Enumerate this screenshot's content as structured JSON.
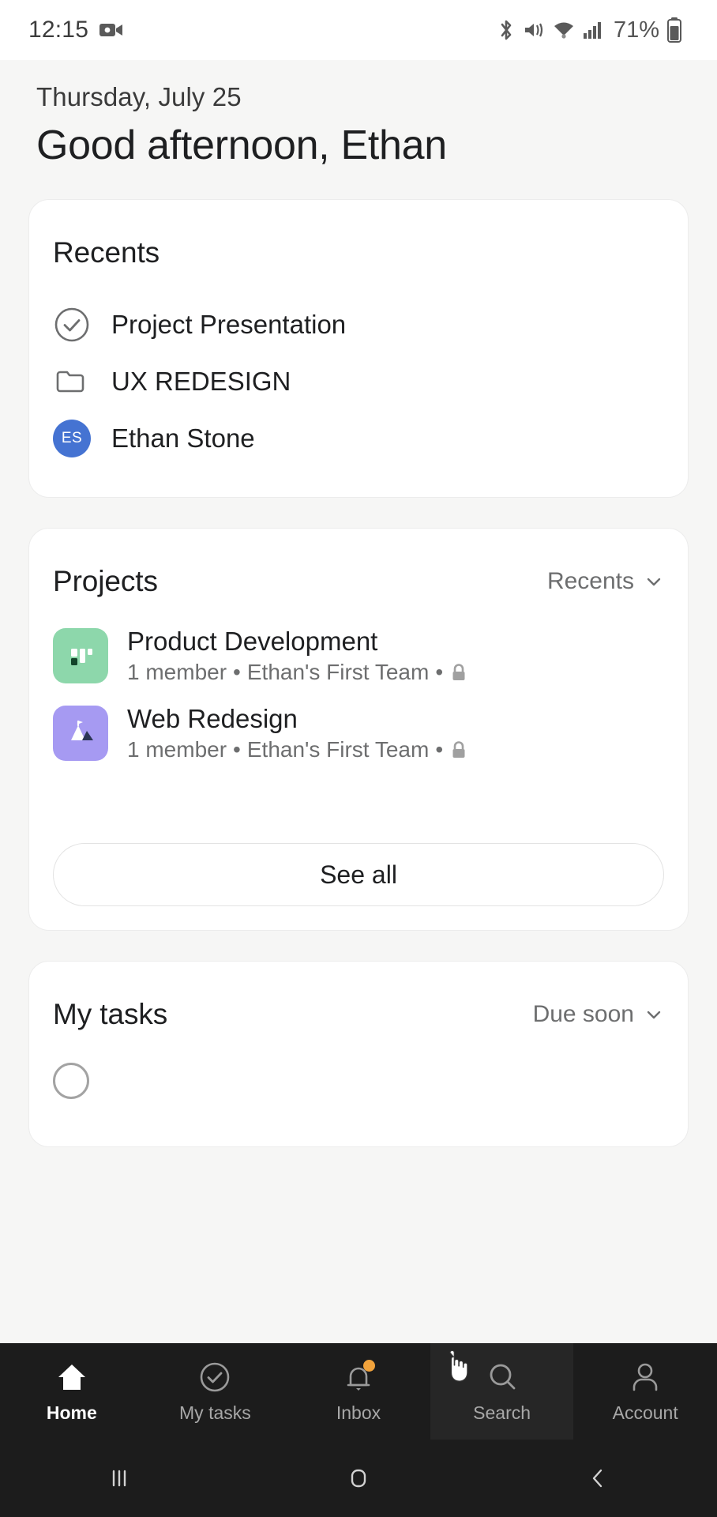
{
  "status_bar": {
    "time": "12:15",
    "battery_percent": "71%",
    "icons": [
      "video-camera-icon",
      "bluetooth-icon",
      "mute-vibrate-icon",
      "wifi-icon",
      "cellular-signal-icon",
      "battery-icon"
    ]
  },
  "greeting": {
    "date": "Thursday, July 25",
    "title": "Good afternoon, Ethan"
  },
  "recents": {
    "title": "Recents",
    "items": [
      {
        "label": "Project Presentation",
        "icon": "check-circle-icon"
      },
      {
        "label": "UX REDESIGN",
        "icon": "folder-icon"
      },
      {
        "label": "Ethan Stone",
        "icon": "avatar",
        "initials": "ES",
        "avatar_color": "#4573d2"
      }
    ]
  },
  "projects": {
    "title": "Projects",
    "sort_label": "Recents",
    "sort_icon": "chevron-down-icon",
    "items": [
      {
        "name": "Product Development",
        "meta_members": "1 member",
        "meta_team": "Ethan's First Team",
        "meta_separator": "•",
        "privacy_icon": "lock-icon",
        "icon": "board-icon",
        "color": "#8dd7ab"
      },
      {
        "name": "Web Redesign",
        "meta_members": "1 member",
        "meta_team": "Ethan's First Team",
        "meta_separator": "•",
        "privacy_icon": "lock-icon",
        "icon": "mountain-flag-icon",
        "color": "#a69af2"
      }
    ],
    "see_all_label": "See all"
  },
  "my_tasks": {
    "title": "My tasks",
    "sort_label": "Due soon",
    "sort_icon": "chevron-down-icon"
  },
  "tabbar": {
    "items": [
      {
        "label": "Home",
        "icon": "home-icon",
        "active": true,
        "pressed": false,
        "badge": false
      },
      {
        "label": "My tasks",
        "icon": "check-circle-icon",
        "active": false,
        "pressed": false,
        "badge": false
      },
      {
        "label": "Inbox",
        "icon": "bell-icon",
        "active": false,
        "pressed": false,
        "badge": true
      },
      {
        "label": "Search",
        "icon": "search-icon",
        "active": false,
        "pressed": true,
        "badge": false
      },
      {
        "label": "Account",
        "icon": "person-icon",
        "active": false,
        "pressed": false,
        "badge": false
      }
    ],
    "badge_color": "#f1a33c",
    "background": "#1c1c1c"
  },
  "android_nav": {
    "recents_icon": "recents-bars-icon",
    "home_icon": "home-square-icon",
    "back_icon": "back-chevron-icon"
  }
}
